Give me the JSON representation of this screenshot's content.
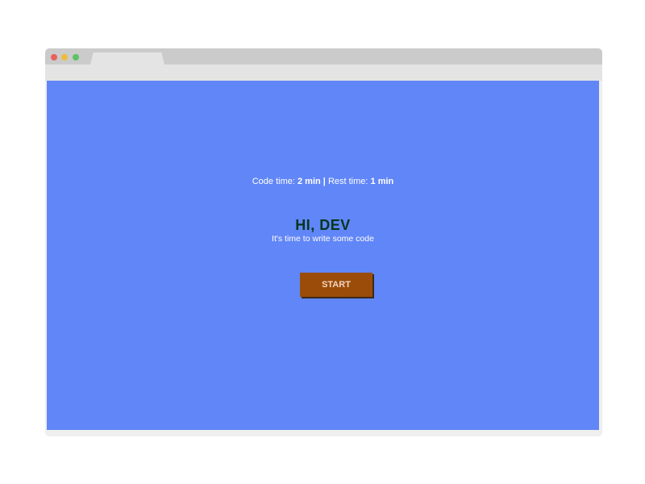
{
  "colors": {
    "page_background": "#6186f7",
    "greeting_text": "#05361d",
    "button_background": "#9b4c09",
    "button_text": "#f3d5c2",
    "button_shadow": "#3a2a1a",
    "dot_red": "#e8615a",
    "dot_yellow": "#ebbd3c",
    "dot_green": "#5ec264"
  },
  "timer": {
    "code_label": "Code time:",
    "code_value": "2 min",
    "separator": "|",
    "rest_label": "Rest time:",
    "rest_value": "1 min"
  },
  "greeting": {
    "title": "HI, DEV",
    "subtitle": "It's time to write some code"
  },
  "start_button": {
    "label": "START"
  }
}
